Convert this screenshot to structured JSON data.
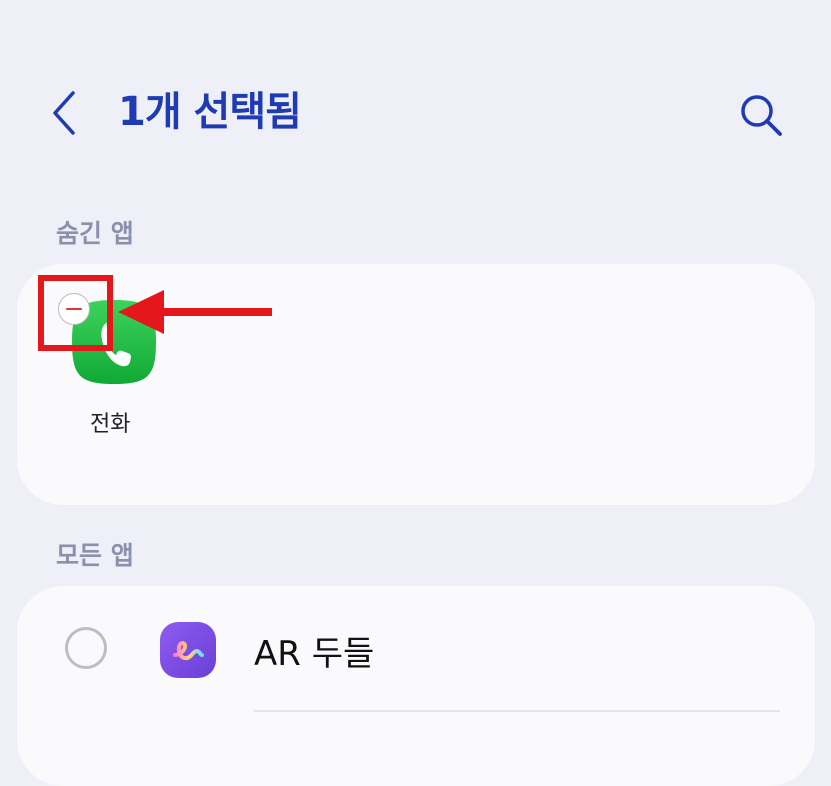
{
  "header": {
    "title": "1개 선택됨",
    "back_icon": "chevron-left-icon",
    "search_icon": "search-icon"
  },
  "sections": {
    "hidden": {
      "label": "숨긴 앱",
      "apps": [
        {
          "label": "전화",
          "icon": "phone-app-icon",
          "badge": "remove-icon"
        }
      ]
    },
    "all": {
      "label": "모든 앱",
      "apps": [
        {
          "label": "AR 두들",
          "icon": "ar-doodle-app-icon",
          "selected": false
        }
      ]
    }
  },
  "colors": {
    "background": "#eff0f7",
    "card": "#fafafd",
    "title": "#1f3bb3",
    "section_label": "#8b90ad",
    "annotation_red": "#e3171c",
    "phone_green": "#1fbf3f",
    "ar_purple": "#7b4be0"
  }
}
